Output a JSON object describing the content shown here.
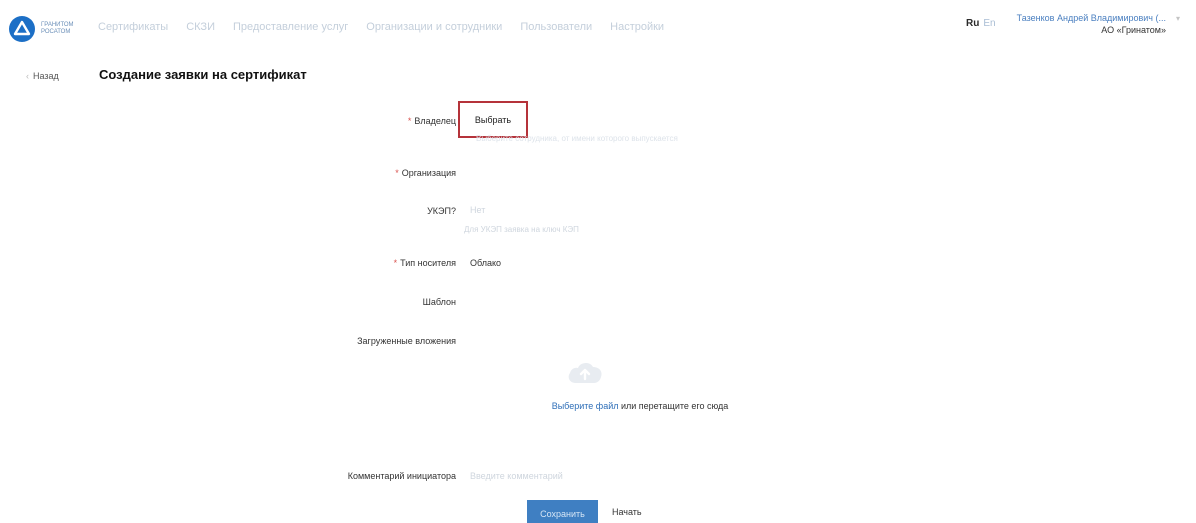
{
  "header": {
    "logo_line1": "ГРАНИТОМ",
    "logo_line2": "РОСАТОМ",
    "nav": [
      "Сертификаты",
      "СКЗИ",
      "Предоставление услуг",
      "Организации и сотрудники",
      "Пользователи",
      "Настройки"
    ],
    "lang_ru": "Ru",
    "lang_en": "En",
    "user_name": "Тазенков Андрей Владимирович (...",
    "user_org": "АО «Гринатом»"
  },
  "page": {
    "back_label": "Назад",
    "title": "Создание заявки на сертификат"
  },
  "form": {
    "owner_label": "Владелец",
    "owner_button": "Выбрать",
    "owner_hint": "Выберите сотрудника, от имени которого выпускается",
    "org_label": "Организация",
    "ukep_label": "УКЭП?",
    "ukep_value": "Нет",
    "ukep_hint": "Для УКЭП заявка на ключ КЭП",
    "media_label": "Тип носителя",
    "media_value": "Облако",
    "template_label": "Шаблон",
    "files_label": "Загруженные вложения",
    "drop_link": "Выберите файл",
    "drop_text": " или перетащите его сюда",
    "comment_label": "Комментарий инициатора",
    "comment_placeholder": "Введите комментарий",
    "save_button": "Сохранить",
    "cancel_button": "Начать"
  },
  "colors": {
    "accent": "#3f7fc2",
    "highlight": "#b5333a",
    "required": "#d9534f"
  }
}
